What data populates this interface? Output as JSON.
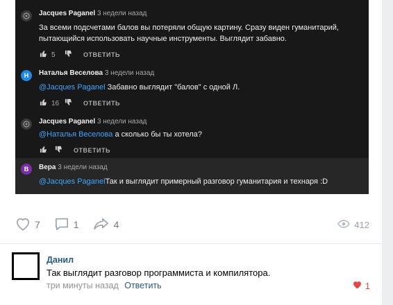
{
  "dark_comments": [
    {
      "initial": "",
      "avatar_color": "#3a3a3a",
      "name": "Jacques Paganel",
      "time": "3 недели назад",
      "mention": "",
      "text": "За всеми подсчетами балов вы потеряли общую картину. Сразу виден гуманитарий, пытающийся использовать научные инструменты. Выглядит забавно.",
      "likes": "5",
      "reply_label": "ОТВЕТИТЬ"
    },
    {
      "initial": "Н",
      "avatar_color": "#1f88e5",
      "name": "Наталья Веселова",
      "time": "3 недели назад",
      "mention": "@Jacques Paganel",
      "text": " Забавно выглядит \"балов\" с одной Л.",
      "likes": "16",
      "reply_label": "ОТВЕТИТЬ"
    },
    {
      "initial": "",
      "avatar_color": "#3a3a3a",
      "name": "Jacques Paganel",
      "time": "3 недели назад",
      "mention": "@Наталья Веселова",
      "text": " а сколько бы ты хотела?",
      "likes": "",
      "reply_label": "ОТВЕТИТЬ"
    },
    {
      "initial": "В",
      "avatar_color": "#7b2ea8",
      "name": "Вера",
      "time": "3 недели назад",
      "mention": "@Jacques Paganel",
      "text": "Так и выглядит примерный разговор гуманитария и технаря :D"
    }
  ],
  "post_actions": {
    "likes": "7",
    "comments": "1",
    "shares": "4",
    "views": "412"
  },
  "comment": {
    "author": "Данил",
    "text": "Так выглядит разговор программиста и компилятора.",
    "time": "три минуты назад",
    "reply_label": "Ответить",
    "likes": "1"
  },
  "icons": {
    "like": "heart-outline-icon",
    "comment": "speech-bubble-icon",
    "share": "share-arrow-icon",
    "views": "eye-icon",
    "thumb_up": "thumb-up-icon",
    "thumb_down": "thumb-down-icon",
    "liked": "heart-filled-icon"
  },
  "colors": {
    "vk_link": "#2a5885",
    "dark_bg": "#181818",
    "mention": "#3ea6ff",
    "liked_red": "#e64646"
  }
}
